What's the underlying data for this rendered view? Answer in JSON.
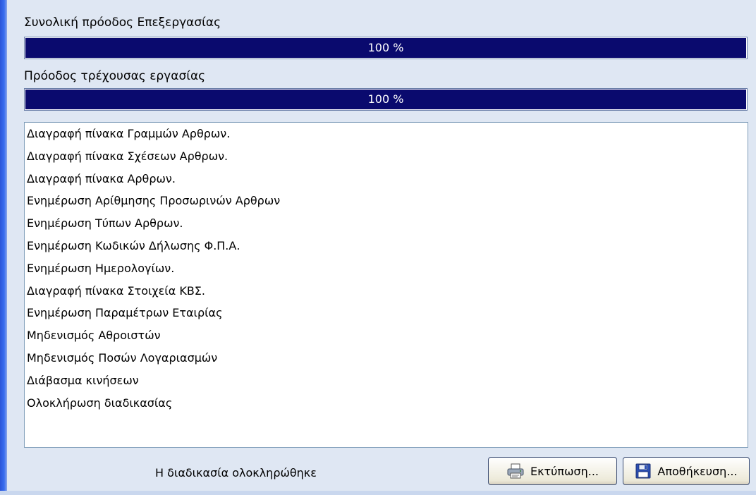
{
  "overall_progress": {
    "label": "Συνολική πρόοδος Επεξεργασίας",
    "value_text": "100 %",
    "fraction": 1.0
  },
  "current_progress": {
    "label": "Πρόοδος τρέχουσας εργασίας",
    "value_text": "100 %",
    "fraction": 1.0
  },
  "log_items": [
    "Διαγραφή πίνακα Γραμμών Αρθρων.",
    "Διαγραφή πίνακα Σχέσεων Αρθρων.",
    "Διαγραφή πίνακα Αρθρων.",
    "Ενημέρωση Αρίθμησης Προσωρινών Αρθρων",
    "Ενημέρωση Τύπων Αρθρων.",
    "Ενημέρωση Κωδικών Δήλωσης Φ.Π.Α.",
    "Ενημέρωση Ημερολογίων.",
    "Διαγραφή πίνακα Στοιχεία ΚΒΣ.",
    "Ενημέρωση Παραμέτρων Εταιρίας",
    "Μηδενισμός Αθροιστών",
    "Μηδενισμός Ποσών Λογαριασμών",
    "Διάβασμα κινήσεων",
    "Ολοκλήρωση διαδικασίας"
  ],
  "status": "Η διαδικασία ολοκληρώθηκε",
  "buttons": {
    "print_label": "Εκτύπωση...",
    "print_icon": "printer-icon",
    "save_label": "Αποθήκευση...",
    "save_icon": "floppy-disk-icon"
  },
  "colors": {
    "progress_fill": "#0a0a6e",
    "window_bg": "#dfe7f3"
  }
}
